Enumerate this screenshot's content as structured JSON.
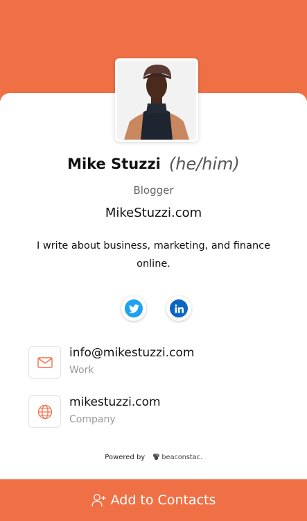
{
  "colors": {
    "accent": "#f07046",
    "twitter": "#1da1f2",
    "linkedin": "#0a66c2"
  },
  "profile": {
    "name": "Mike Stuzzi",
    "pronouns": "(he/him)",
    "title": "Blogger",
    "website": "MikeStuzzi.com",
    "bio": "I write about business, marketing, and finance online."
  },
  "social": [
    {
      "icon": "twitter-icon"
    },
    {
      "icon": "linkedin-icon"
    }
  ],
  "contacts": {
    "email": {
      "value": "info@mikestuzzi.com",
      "label": "Work",
      "icon": "mail-icon"
    },
    "web": {
      "value": "mikestuzzi.com",
      "label": "Company",
      "icon": "globe-icon"
    }
  },
  "footer": {
    "powered_by": "Powered by",
    "brand": "beaconstac."
  },
  "actions": {
    "add_contact_label": "Add to Contacts",
    "icon": "add-user-icon"
  }
}
